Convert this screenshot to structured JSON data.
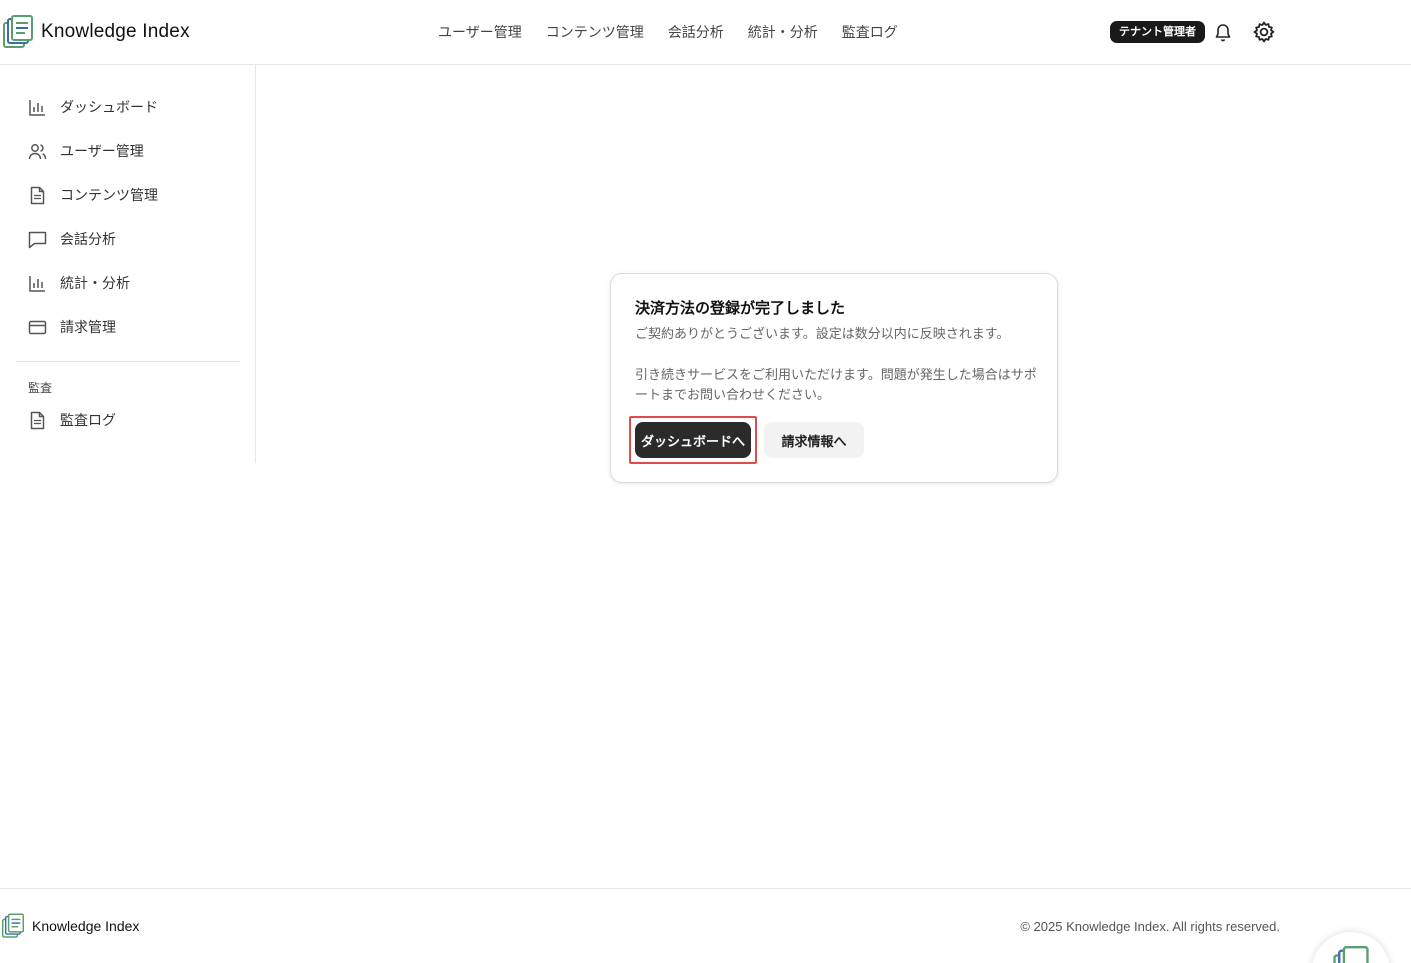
{
  "brand": {
    "name": "Knowledge Index"
  },
  "topnav": [
    {
      "label": "ユーザー管理"
    },
    {
      "label": "コンテンツ管理"
    },
    {
      "label": "会話分析"
    },
    {
      "label": "統計・分析"
    },
    {
      "label": "監査ログ"
    }
  ],
  "header": {
    "role_badge": "テナント管理者",
    "bell_icon": "bell-icon",
    "settings_icon": "gear-icon"
  },
  "sidebar": {
    "items": [
      {
        "label": "ダッシュボード",
        "icon": "bar-chart-icon"
      },
      {
        "label": "ユーザー管理",
        "icon": "users-icon"
      },
      {
        "label": "コンテンツ管理",
        "icon": "document-icon"
      },
      {
        "label": "会話分析",
        "icon": "chat-icon"
      },
      {
        "label": "統計・分析",
        "icon": "bar-chart-icon"
      },
      {
        "label": "請求管理",
        "icon": "credit-card-icon"
      }
    ],
    "section_label": "監査",
    "section_items": [
      {
        "label": "監査ログ",
        "icon": "document-icon"
      }
    ]
  },
  "card": {
    "title": "決済方法の登録が完了しました",
    "subtitle": "ご契約ありがとうございます。設定は数分以内に反映されます。",
    "body": "引き続きサービスをご利用いただけます。問題が発生した場合はサポートまでお問い合わせください。",
    "primary_button": "ダッシュボードへ",
    "secondary_button": "請求情報へ"
  },
  "footer": {
    "name": "Knowledge Index",
    "copyright": "© 2025 Knowledge Index. All rights reserved."
  },
  "colors": {
    "accent_dark": "#2b2b2b",
    "highlight": "#e04b4b",
    "logo_green": "#5a9e6f",
    "logo_blue": "#3b6fa8"
  }
}
